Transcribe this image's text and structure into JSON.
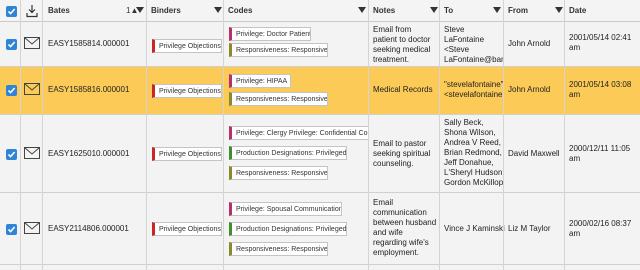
{
  "header": {
    "bates": "Bates",
    "sort_indicator": "1▲",
    "binders": "Binders",
    "codes": "Codes",
    "notes": "Notes",
    "to": "To",
    "from": "From",
    "date": "Date"
  },
  "rows": [
    {
      "bates": "EASY1585814.000001",
      "binder": "Privilege Objections",
      "codes": [
        "Privilege: Doctor Patient",
        "Responsiveness: Responsive"
      ],
      "notes": [
        "Email from",
        "patient to doctor",
        "seeking medical",
        "treatment."
      ],
      "to": [
        "Steve",
        "LaFontaine",
        "<Steve",
        "LaFontaine@bank"
      ],
      "from": "John Arnold",
      "date": "2001/05/14 02:41 am"
    },
    {
      "bates": "EASY1585816.000001",
      "binder": "Privilege Objections",
      "codes": [
        "Privilege: HIPAA",
        "Responsiveness: Responsive"
      ],
      "notes": [
        "Medical Records"
      ],
      "to": [
        "\"stevelafontaine\"",
        "<stevelafontaine@"
      ],
      "from": "John Arnold",
      "date": "2001/05/14 03:08 am"
    },
    {
      "bates": "EASY1625010.000001",
      "binder": "Privilege Objections",
      "codes": [
        "Privilege: Clergy Privilege: Confidential Comm",
        "Production Designations: Privileged",
        "Responsiveness: Responsive"
      ],
      "notes": [
        "Email to pastor",
        "seeking spiritual",
        "counseling."
      ],
      "to": [
        "Sally Beck,",
        "Shona Wilson,",
        "Andrea V Reed,",
        "Brian Redmond,",
        "Jeff Donahue,",
        "L'Sheryl Hudson,",
        "Gordon McKillop"
      ],
      "from": "David Maxwell",
      "date": "2000/12/11 11:05 am"
    },
    {
      "bates": "EASY2114806.000001",
      "binder": "Privilege Objections",
      "codes": [
        "Privilege: Spousal Communication",
        "Production Designations: Privileged",
        "Responsiveness: Responsive"
      ],
      "notes": [
        "Email",
        "communication",
        "between husband",
        "and wife",
        "regarding wife's",
        "employment."
      ],
      "to": [
        "Vince J Kaminski"
      ],
      "from": "Liz M Taylor",
      "date": "2000/02/16 08:37 am"
    }
  ]
}
